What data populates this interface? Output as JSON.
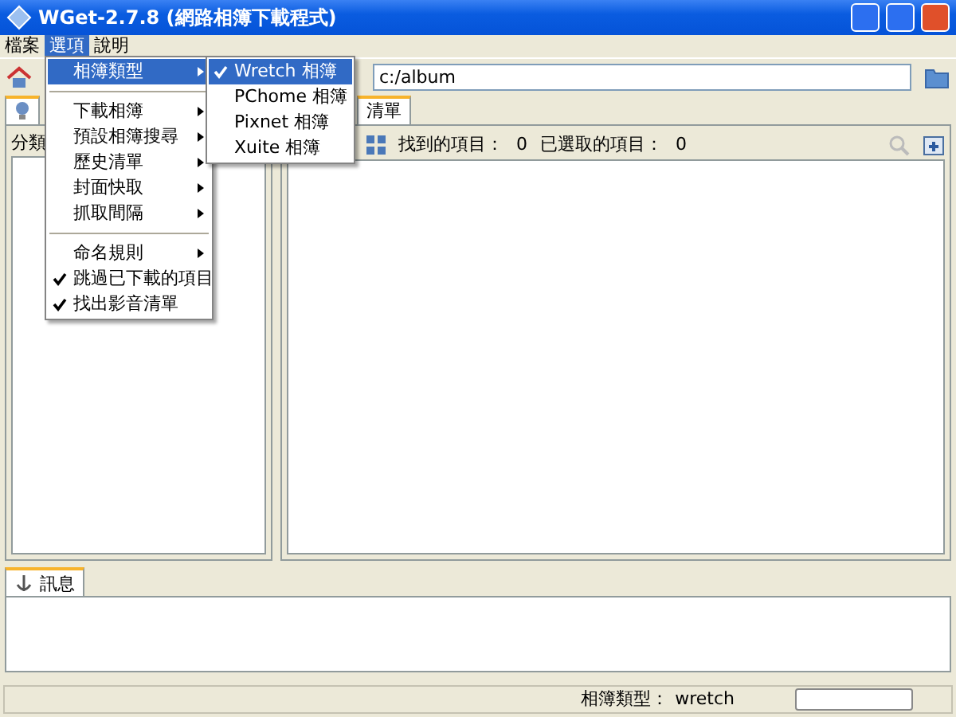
{
  "window": {
    "title": "WGet-2.7.8 (網路相簿下載程式)"
  },
  "menu_bar": [
    {
      "label": "檔案",
      "selected": false
    },
    {
      "label": "選項",
      "selected": true
    },
    {
      "label": "說明",
      "selected": false
    }
  ],
  "options_menu": [
    {
      "kind": "submenu",
      "label": "相簿類型",
      "selected": true
    },
    {
      "kind": "separator"
    },
    {
      "kind": "submenu",
      "label": "下載相簿",
      "selected": false
    },
    {
      "kind": "submenu",
      "label": "預設相簿搜尋",
      "selected": false
    },
    {
      "kind": "submenu",
      "label": "歷史清單",
      "selected": false
    },
    {
      "kind": "submenu",
      "label": "封面快取",
      "selected": false
    },
    {
      "kind": "submenu",
      "label": "抓取間隔",
      "selected": false
    },
    {
      "kind": "separator"
    },
    {
      "kind": "submenu",
      "label": "命名規則",
      "selected": false
    },
    {
      "kind": "check",
      "label": "跳過已下載的項目",
      "checked": true
    },
    {
      "kind": "check",
      "label": "找出影音清單",
      "checked": true
    }
  ],
  "album_type_submenu": [
    {
      "label": "Wretch 相簿",
      "checked": true,
      "selected": true
    },
    {
      "label": "PChome 相簿",
      "checked": false,
      "selected": false
    },
    {
      "label": "Pixnet 相簿",
      "checked": false,
      "selected": false
    },
    {
      "label": "Xuite 相簿",
      "checked": false,
      "selected": false
    }
  ],
  "path_field": {
    "value": "c:/album"
  },
  "left_panel": {
    "column_label": "分類"
  },
  "right_panel": {
    "tab": "清單",
    "found_label": "找到的項目：",
    "found_count": "0",
    "selected_label": "已選取的項目：",
    "selected_count": "0"
  },
  "message_panel": {
    "tab": "訊息"
  },
  "status_bar": {
    "label": "相簿類型：",
    "value": "wretch"
  }
}
